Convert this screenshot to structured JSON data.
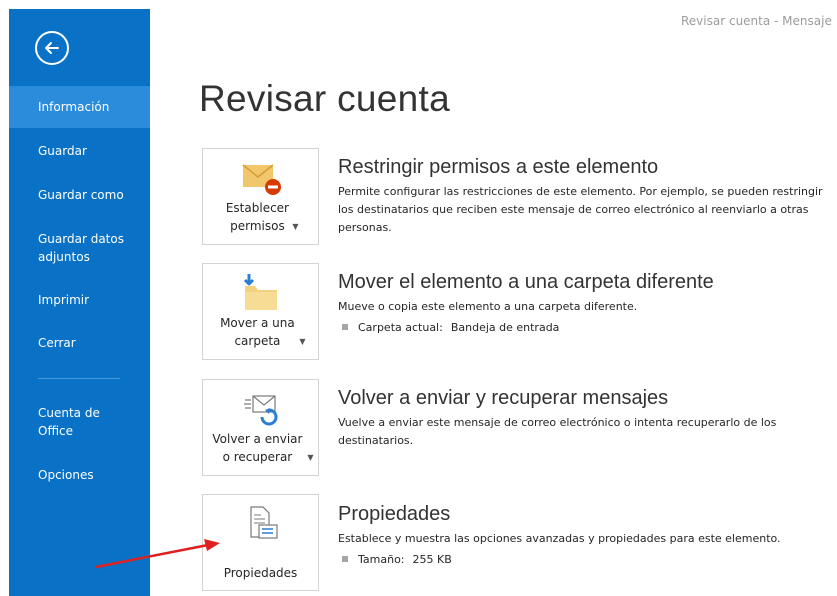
{
  "window": {
    "title": "Revisar cuenta - Mensaje"
  },
  "sidebar": {
    "items": [
      {
        "label": "Información"
      },
      {
        "label": "Guardar"
      },
      {
        "label": "Guardar como"
      },
      {
        "label": "Guardar datos adjuntos"
      },
      {
        "label": "Imprimir"
      },
      {
        "label": "Cerrar"
      },
      {
        "label": "Cuenta de Office"
      },
      {
        "label": "Opciones"
      }
    ]
  },
  "main": {
    "title": "Revisar cuenta",
    "sections": [
      {
        "button_label": "Establecer permisos",
        "icon": "envelope-restrict-icon",
        "title": "Restringir permisos a este elemento",
        "description": "Permite configurar las restricciones de este elemento. Por ejemplo, se pueden restringir los destinatarios que reciben este mensaje de correo electrónico al reenviarlo a otras personas."
      },
      {
        "button_label": "Mover a una carpeta",
        "icon": "folder-move-icon",
        "title": "Mover el elemento a una carpeta diferente",
        "description": "Mueve o copia este elemento a una carpeta diferente.",
        "detail_label": "Carpeta actual:",
        "detail_value": "Bandeja de entrada"
      },
      {
        "button_label": "Volver a enviar o recuperar",
        "icon": "resend-recall-icon",
        "title": "Volver a enviar y recuperar mensajes",
        "description": "Vuelve a enviar este mensaje de correo electrónico o intenta recuperarlo de los destinatarios."
      },
      {
        "button_label": "Propiedades",
        "icon": "properties-icon",
        "title": "Propiedades",
        "description": "Establece y muestra las opciones avanzadas y propiedades para este elemento.",
        "detail_label": "Tamaño:",
        "detail_value": "255 KB"
      }
    ]
  },
  "colors": {
    "sidebar": "#0a72c6",
    "sidebar_active": "#2b8cdc",
    "annotation_arrow": "#e02020"
  }
}
